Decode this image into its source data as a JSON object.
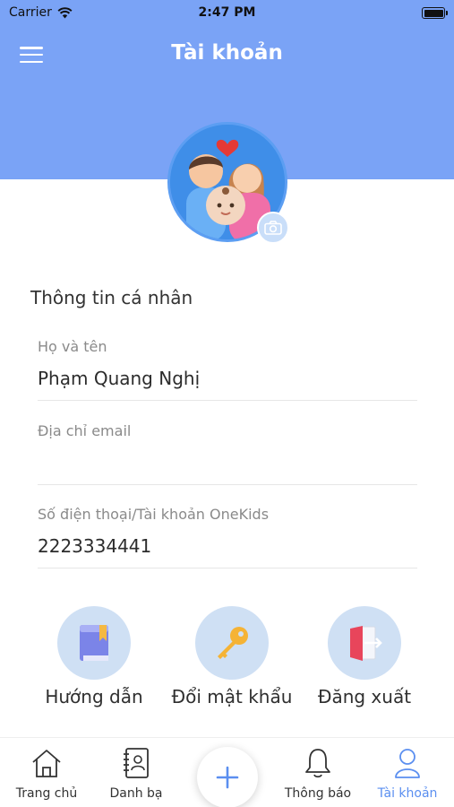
{
  "status_bar": {
    "carrier": "Carrier",
    "time": "2:47 PM"
  },
  "header": {
    "title": "Tài khoản",
    "menu_icon": "hamburger-menu-icon"
  },
  "profile": {
    "avatar_icon": "family-avatar-icon",
    "camera_icon": "camera-icon"
  },
  "personal_info": {
    "section_title": "Thông tin cá nhân",
    "fields": [
      {
        "label": "Họ và tên",
        "value": "Phạm Quang Nghị"
      },
      {
        "label": "Địa chỉ email",
        "value": ""
      },
      {
        "label": "Số điện thoại/Tài khoản OneKids",
        "value": "2223334441"
      }
    ]
  },
  "actions": [
    {
      "label": "Hướng dẫn",
      "icon": "guide-book-icon"
    },
    {
      "label": "Đổi mật khẩu",
      "icon": "key-icon"
    },
    {
      "label": "Đăng xuất",
      "icon": "logout-door-icon"
    }
  ],
  "tabbar": {
    "tabs": [
      {
        "label": "Trang chủ",
        "icon": "home-icon"
      },
      {
        "label": "Danh bạ",
        "icon": "contacts-icon"
      },
      {
        "label": "Thông báo",
        "icon": "bell-icon"
      },
      {
        "label": "Tài khoản",
        "icon": "user-icon",
        "active": true
      }
    ],
    "fab_icon": "plus-icon"
  },
  "colors": {
    "header_bg": "#7aa3f6",
    "accent": "#5b8ff0",
    "action_circle": "#cfe0f4"
  }
}
